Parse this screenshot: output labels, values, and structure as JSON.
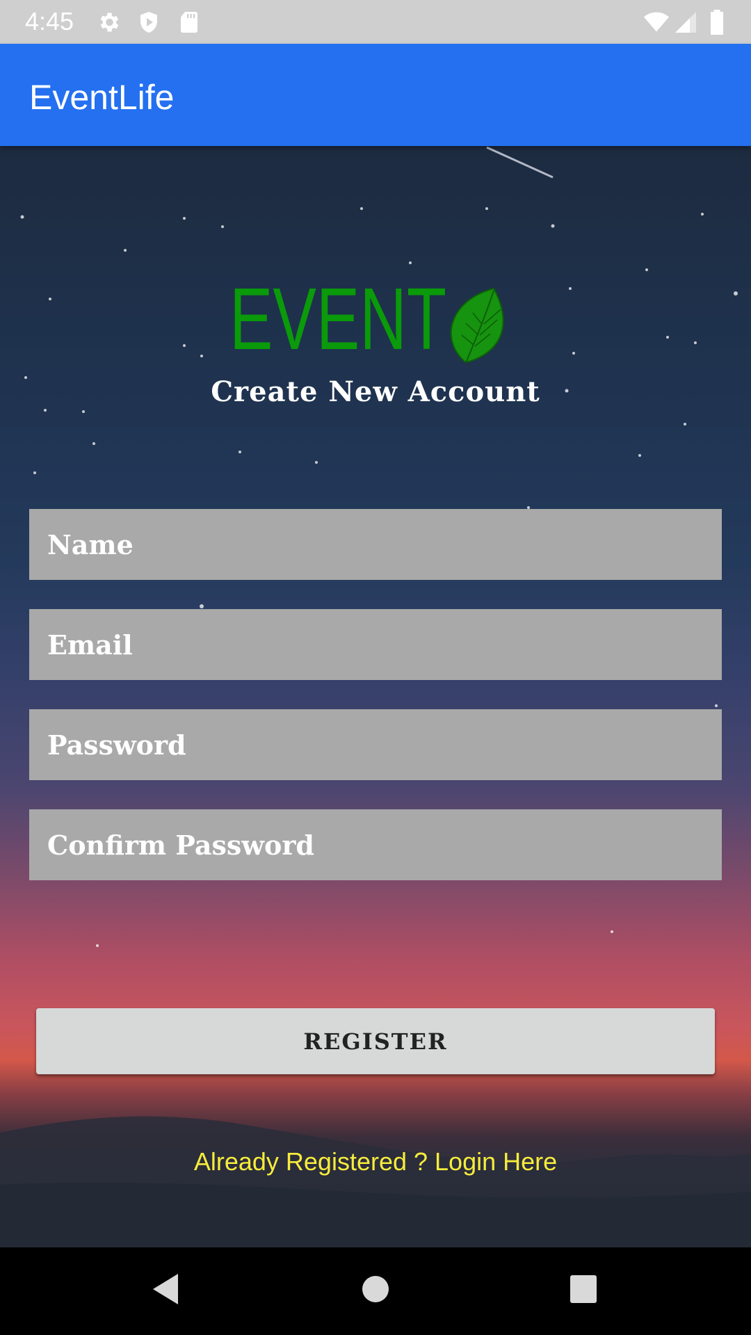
{
  "status_bar": {
    "time": "4:45",
    "left_icons": [
      "gear-icon",
      "shield-play-icon",
      "sd-card-icon"
    ],
    "right_icons": [
      "wifi-icon",
      "signal-icon",
      "battery-icon"
    ]
  },
  "app_bar": {
    "title": "EventLife"
  },
  "logo": {
    "text": "EVENT",
    "color": "#0a9a0a"
  },
  "subtitle": "Create New Account",
  "form": {
    "name_placeholder": "Name",
    "email_placeholder": "Email",
    "password_placeholder": "Password",
    "confirm_password_placeholder": "Confirm Password"
  },
  "register_label": "REGISTER",
  "login_link": "Already Registered ? Login Here",
  "nav_bar": {
    "buttons": [
      "back-icon",
      "home-icon",
      "recents-icon"
    ]
  },
  "colors": {
    "app_bar": "#2470f0",
    "field_bg": "#a9a9a9",
    "link": "#f7ec3c",
    "button_bg": "#d7d8d8"
  }
}
